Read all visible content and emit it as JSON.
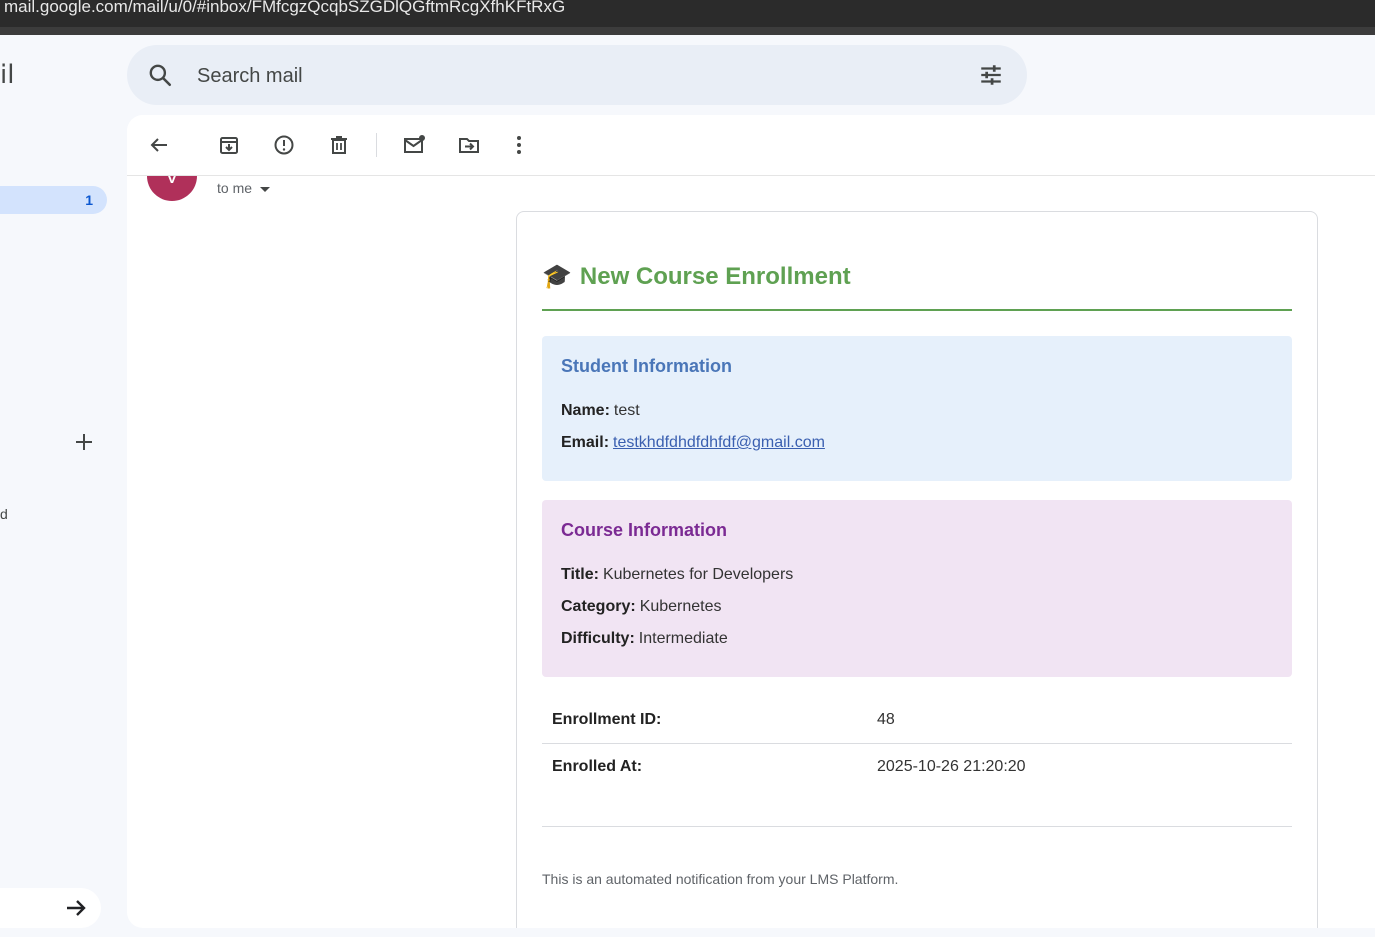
{
  "browser": {
    "url": "mail.google.com/mail/u/0/#inbox/FMfcgzQcqbSZGDlQGftmRcgXfhKFtRxG"
  },
  "app": {
    "logo_fragment": "il"
  },
  "search": {
    "placeholder": "Search mail"
  },
  "sidebar": {
    "inbox_count": "1",
    "fragment_text": "d"
  },
  "toolbar": {
    "icons": [
      "back-arrow-icon",
      "archive-icon",
      "report-spam-icon",
      "delete-icon",
      "mark-unread-icon",
      "move-to-icon",
      "more-options-icon"
    ]
  },
  "message": {
    "avatar_letter": "V",
    "recipient": "to me"
  },
  "email": {
    "heading_icon": "🎓",
    "heading": "New Course Enrollment",
    "student": {
      "title": "Student Information",
      "name_label": "Name:",
      "name_value": "test",
      "email_label": "Email:",
      "email_value": "testkhdfdhdfdhfdf@gmail.com"
    },
    "course": {
      "title": "Course Information",
      "title_label": "Title:",
      "title_value": "Kubernetes for Developers",
      "category_label": "Category:",
      "category_value": "Kubernetes",
      "difficulty_label": "Difficulty:",
      "difficulty_value": "Intermediate"
    },
    "details": [
      {
        "label": "Enrollment ID:",
        "value": "48"
      },
      {
        "label": "Enrolled At:",
        "value": "2025-10-26 21:20:20"
      }
    ],
    "footer": "This is an automated notification from your LMS Platform."
  },
  "colors": {
    "accent_green": "#5fa152",
    "student_blue": "#4a76b8",
    "course_purple": "#7b2a93",
    "avatar": "#b0305a"
  }
}
